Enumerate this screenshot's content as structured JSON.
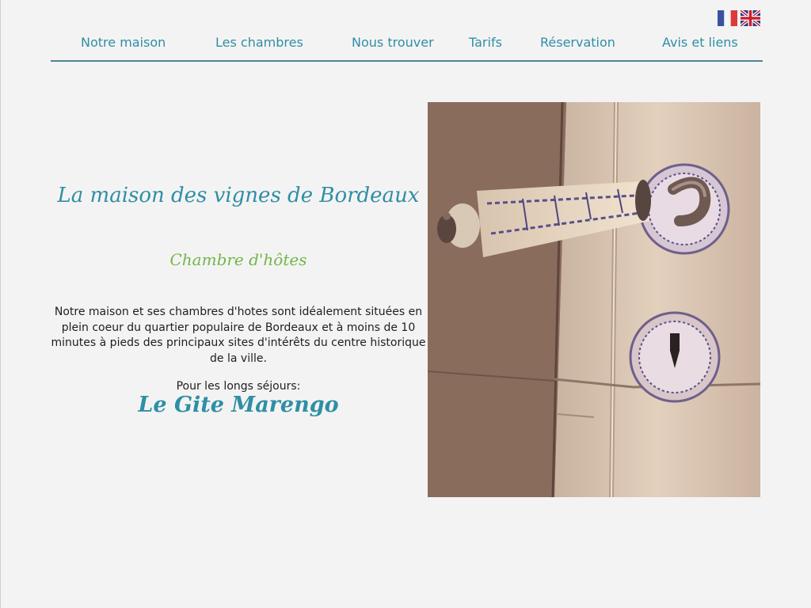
{
  "flags": {
    "fr_icon": "flag-france-icon",
    "en_icon": "flag-uk-icon"
  },
  "nav": {
    "items": [
      {
        "label": "Notre maison"
      },
      {
        "label": "Les chambres"
      },
      {
        "label": "Nous trouver"
      },
      {
        "label": "Tarifs"
      },
      {
        "label": "Réservation"
      },
      {
        "label": "Avis et liens"
      }
    ]
  },
  "main": {
    "title": "La maison des vignes de Bordeaux",
    "subtitle": "Chambre d'hôtes",
    "description": "Notre maison et ses chambres d'hotes sont idéalement situées en plein coeur du quartier populaire de Bordeaux et à moins de 10 minutes à pieds des principaux sites d'intérêts du centre historique de la ville.",
    "long_stay_label": "Pour les longs séjours:",
    "gite_link": "Le Gite Marengo"
  },
  "colors": {
    "background": "#f4f3f3",
    "accent_blue": "#2e8fa5",
    "accent_green": "#72b64b",
    "nav_rule": "#4d8497"
  }
}
